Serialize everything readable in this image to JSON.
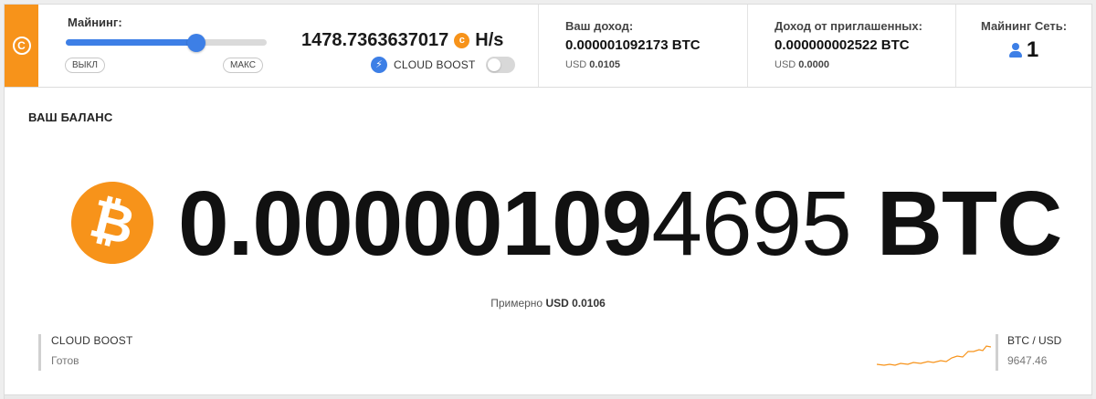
{
  "topbar": {
    "logo_icon": "cryptotab-logo-icon",
    "mining": {
      "label": "Майнинг:",
      "slider_level_percent": 65,
      "off_label": "ВЫКЛ",
      "max_label": "МАКС",
      "hashrate": "1478.7363637017",
      "hashrate_unit": "H/s",
      "coin_icon": "coin-icon",
      "boost_icon": "bolt-icon",
      "boost_label": "CLOUD BOOST",
      "boost_enabled": false
    },
    "income": {
      "label": "Ваш доход:",
      "value": "0.000001092173 BTC",
      "usd_prefix": "USD",
      "usd_value": "0.0105"
    },
    "referral_income": {
      "label": "Доход от приглашенных:",
      "value": "0.000000002522 BTC",
      "usd_prefix": "USD",
      "usd_value": "0.0000"
    },
    "network": {
      "label": "Майнинг Сеть:",
      "icon": "user-icon",
      "count": "1"
    }
  },
  "balance": {
    "title": "ВАШ БАЛАНС",
    "btc_icon": "bitcoin-icon",
    "amount_strong": "0.00000109",
    "amount_light": "4695",
    "unit": "BTC",
    "approx_label": "Примерно",
    "approx_value": "USD 0.0106",
    "cloud_boost": {
      "title": "CLOUD BOOST",
      "status": "Готов"
    },
    "rate": {
      "label": "BTC / USD",
      "value": "9647.46",
      "sparkline_color": "#f7931a"
    }
  },
  "colors": {
    "accent_orange": "#f7931a",
    "accent_blue": "#3d7fe6"
  }
}
